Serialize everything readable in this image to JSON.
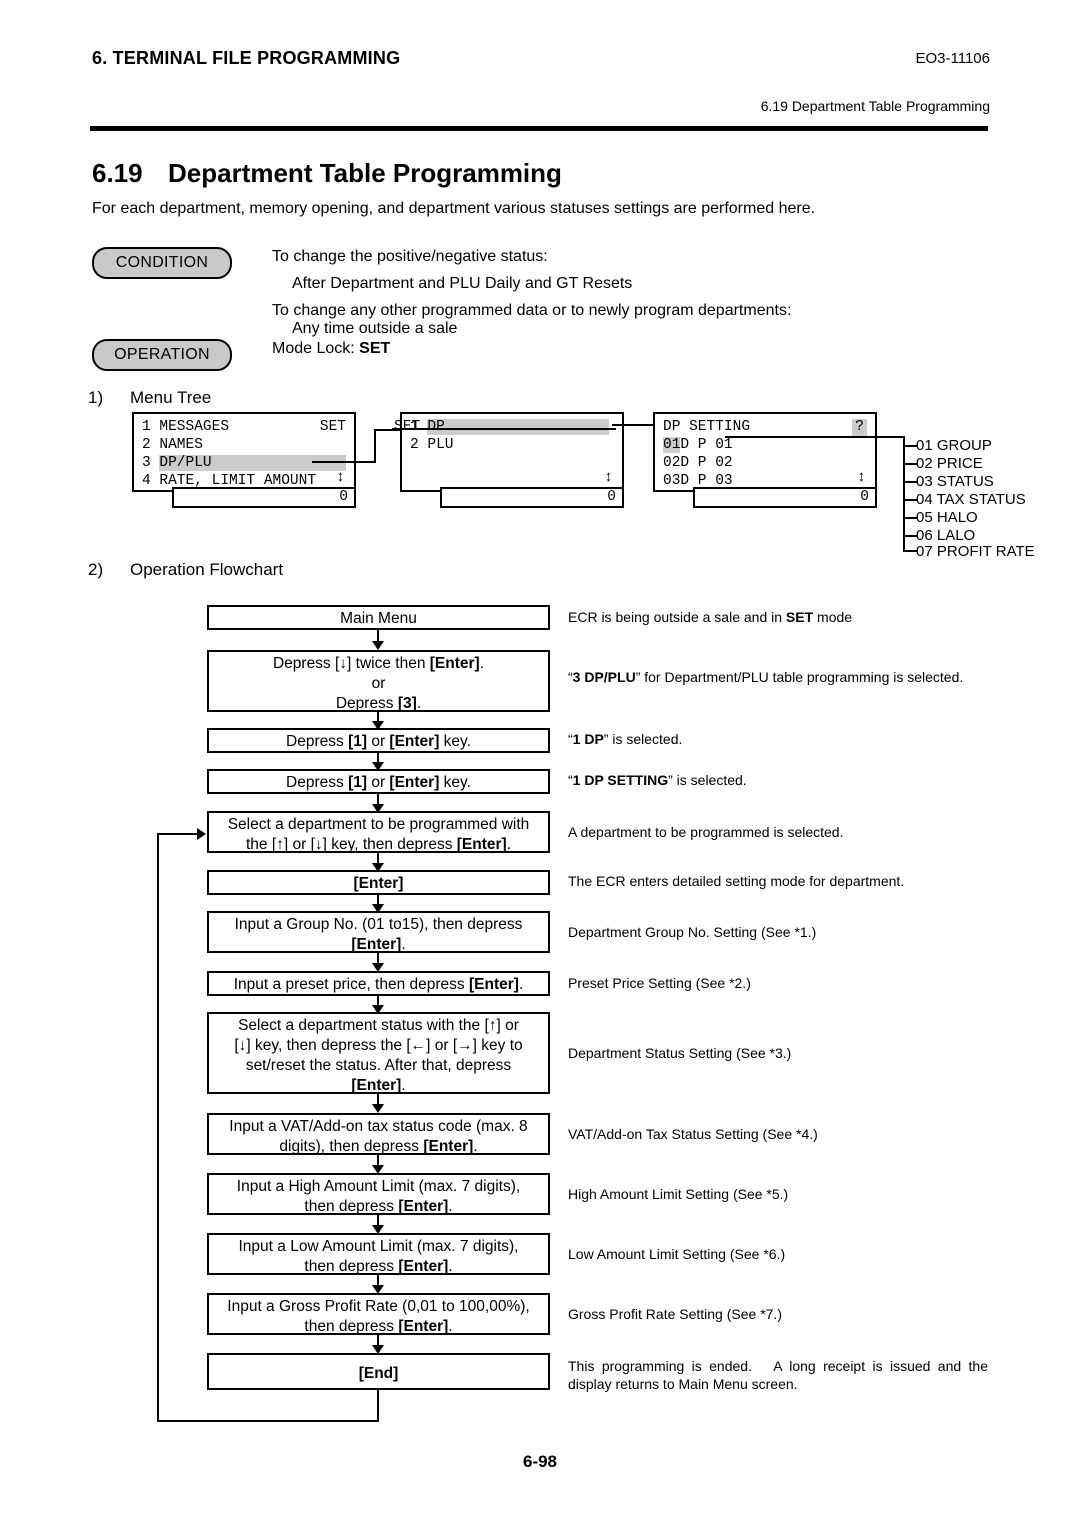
{
  "header": {
    "chapter_title": "6. TERMINAL FILE PROGRAMMING",
    "doc_code": "EO3-11106",
    "running_head": "6.19 Department Table Programming"
  },
  "section": {
    "number": "6.19",
    "title": "Department Table Programming",
    "intro": "For each department, memory opening, and department various statuses settings are performed here."
  },
  "condition": {
    "pill_label": "CONDITION",
    "lines": [
      "To change the positive/negative status:",
      "After Department and PLU Daily and GT Resets",
      "To change any other programmed data or to newly program departments:",
      "Any time outside a sale"
    ]
  },
  "operation": {
    "pill_label": "OPERATION",
    "mode_lock_prefix": "Mode Lock: ",
    "mode_lock_value": "SET"
  },
  "menu_tree": {
    "list_number": "1)",
    "list_label": "Menu Tree",
    "screen1": {
      "rows": [
        {
          "num": "1",
          "text": "MESSAGES",
          "right": "SET",
          "highlight": false
        },
        {
          "num": "2",
          "text": "NAMES",
          "right": "",
          "highlight": false
        },
        {
          "num": "3",
          "text": "DP/PLU",
          "right": "",
          "highlight": true
        },
        {
          "num": "4",
          "text": "RATE, LIMIT AMOUNT",
          "right": "",
          "highlight": false
        }
      ],
      "scroll_icon": "↕",
      "footer_value": "0"
    },
    "screen2": {
      "rows": [
        {
          "num": "1",
          "text": "DP",
          "right": "SET",
          "highlight": true
        },
        {
          "num": "2",
          "text": "PLU",
          "right": "",
          "highlight": false
        }
      ],
      "scroll_icon": "↕",
      "footer_value": "0"
    },
    "screen3": {
      "title": "DP SETTING",
      "help_icon": "?",
      "rows": [
        {
          "num": "01",
          "text": "D P 01",
          "highlight": true
        },
        {
          "num": "02",
          "text": "D P 02",
          "highlight": false
        },
        {
          "num": "03",
          "text": "D P 03",
          "highlight": false
        }
      ],
      "scroll_icon": "↕",
      "footer_value": "0"
    },
    "settings": [
      "01 GROUP",
      "02 PRICE",
      "03 STATUS",
      "04 TAX STATUS",
      "05 HALO",
      "06 LALO",
      "07 PROFIT RATE"
    ]
  },
  "flowchart": {
    "list_number": "2)",
    "list_label": "Operation Flowchart",
    "steps": [
      {
        "box_lines": [
          "Main Menu"
        ],
        "note_html": "ECR is being outside a sale and in <b>SET</b> mode"
      },
      {
        "box_lines": [
          "Depress [↓] twice then <b>[Enter]</b>.",
          "or",
          "Depress <b>[3]</b>."
        ],
        "note_html": "“<b>3 DP/PLU</b>” for Department/PLU table programming is selected."
      },
      {
        "box_lines": [
          "Depress <b>[1]</b> or <b>[Enter]</b> key."
        ],
        "note_html": "“<b>1 DP</b>” is selected."
      },
      {
        "box_lines": [
          "Depress <b>[1]</b> or <b>[Enter]</b> key."
        ],
        "note_html": "“<b>1 DP SETTING</b>” is selected."
      },
      {
        "box_lines": [
          "Select a department to be programmed with",
          "the [↑] or [↓] key, then depress <b>[Enter]</b>."
        ],
        "note_html": "A department to be programmed is selected."
      },
      {
        "box_lines": [
          "<b>[Enter]</b>"
        ],
        "note_html": "The ECR enters detailed setting mode for department."
      },
      {
        "box_lines": [
          "Input a Group No. (01 to15), then depress",
          "<b>[Enter]</b>."
        ],
        "note_html": "Department Group No. Setting (See *1.)"
      },
      {
        "box_lines": [
          "Input a preset price, then depress <b>[Enter]</b>."
        ],
        "note_html": "Preset Price Setting (See *2.)"
      },
      {
        "box_lines": [
          "Select a department status with the [↑] or",
          "[↓] key, then depress the [←] or [→] key to",
          "set/reset the status.  After that, depress",
          "<b>[Enter]</b>."
        ],
        "note_html": "Department Status Setting (See *3.)"
      },
      {
        "box_lines": [
          "Input a VAT/Add-on tax status code (max. 8",
          "digits), then depress <b>[Enter]</b>."
        ],
        "note_html": "VAT/Add-on Tax Status Setting (See *4.)"
      },
      {
        "box_lines": [
          "Input a High Amount Limit (max. 7 digits),",
          "then depress <b>[Enter]</b>."
        ],
        "note_html": "High Amount Limit Setting (See *5.)"
      },
      {
        "box_lines": [
          "Input a Low Amount Limit (max. 7 digits),",
          "then depress <b>[Enter]</b>."
        ],
        "note_html": "Low Amount Limit Setting (See *6.)"
      },
      {
        "box_lines": [
          "Input a Gross Profit Rate (0,01 to 100,00%),",
          "then depress <b>[Enter]</b>."
        ],
        "note_html": "Gross Profit Rate Setting (See *7.)"
      },
      {
        "box_lines": [
          "<b>[End]</b>"
        ],
        "note_html": "This programming is ended.&nbsp;&nbsp; A long receipt is issued and the display returns to Main Menu screen."
      }
    ]
  },
  "footer": {
    "page_number": "6-98"
  }
}
